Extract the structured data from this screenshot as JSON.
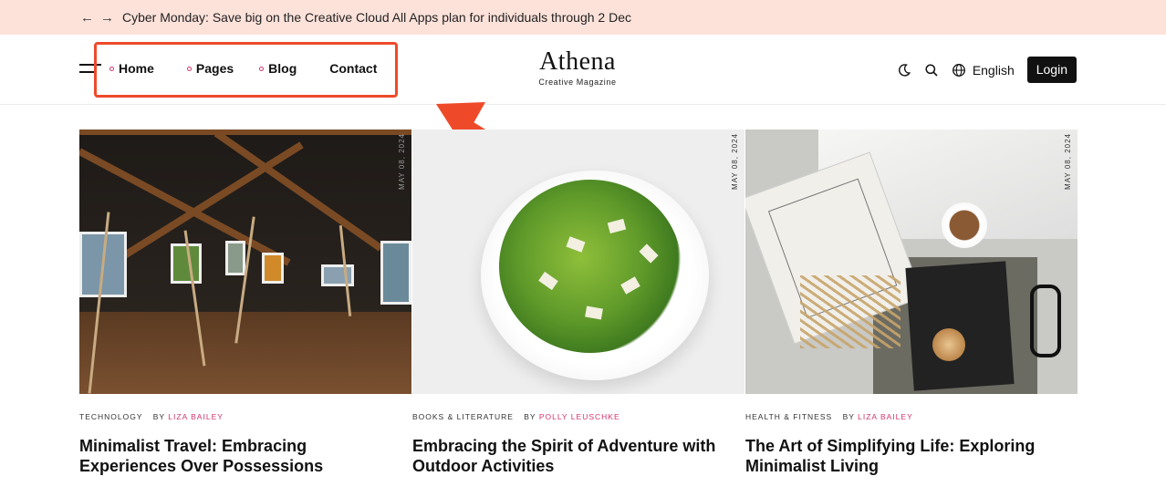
{
  "promo": {
    "back_icon": "arrow-left-icon",
    "forward_icon": "arrow-right-icon",
    "text": "Cyber Monday: Save big on the Creative Cloud All Apps plan for individuals through 2 Dec"
  },
  "header": {
    "nav": [
      {
        "label": "Home"
      },
      {
        "label": "Pages"
      },
      {
        "label": "Blog"
      },
      {
        "label": "Contact"
      }
    ],
    "brand_name": "Athena",
    "brand_tagline": "Creative Magazine",
    "language": "English",
    "login_label": "Login"
  },
  "colors": {
    "promo_bg": "#fde2da",
    "accent": "#d6336c",
    "annotation": "#ee4a2a"
  },
  "posts": [
    {
      "date": "MAY 08, 2024",
      "category": "TECHNOLOGY",
      "by": "BY",
      "author": "LIZA BAILEY",
      "title": "Minimalist Travel: Embracing Experiences Over Possessions"
    },
    {
      "date": "MAY 08, 2024",
      "category": "BOOKS & LITERATURE",
      "by": "BY",
      "author": "POLLY LEUSCHKE",
      "title": "Embracing the Spirit of Adventure with Outdoor Activities"
    },
    {
      "date": "MAY 08, 2024",
      "category": "HEALTH & FITNESS",
      "by": "BY",
      "author": "LIZA BAILEY",
      "title": "The Art of Simplifying Life: Exploring Minimalist Living"
    }
  ]
}
